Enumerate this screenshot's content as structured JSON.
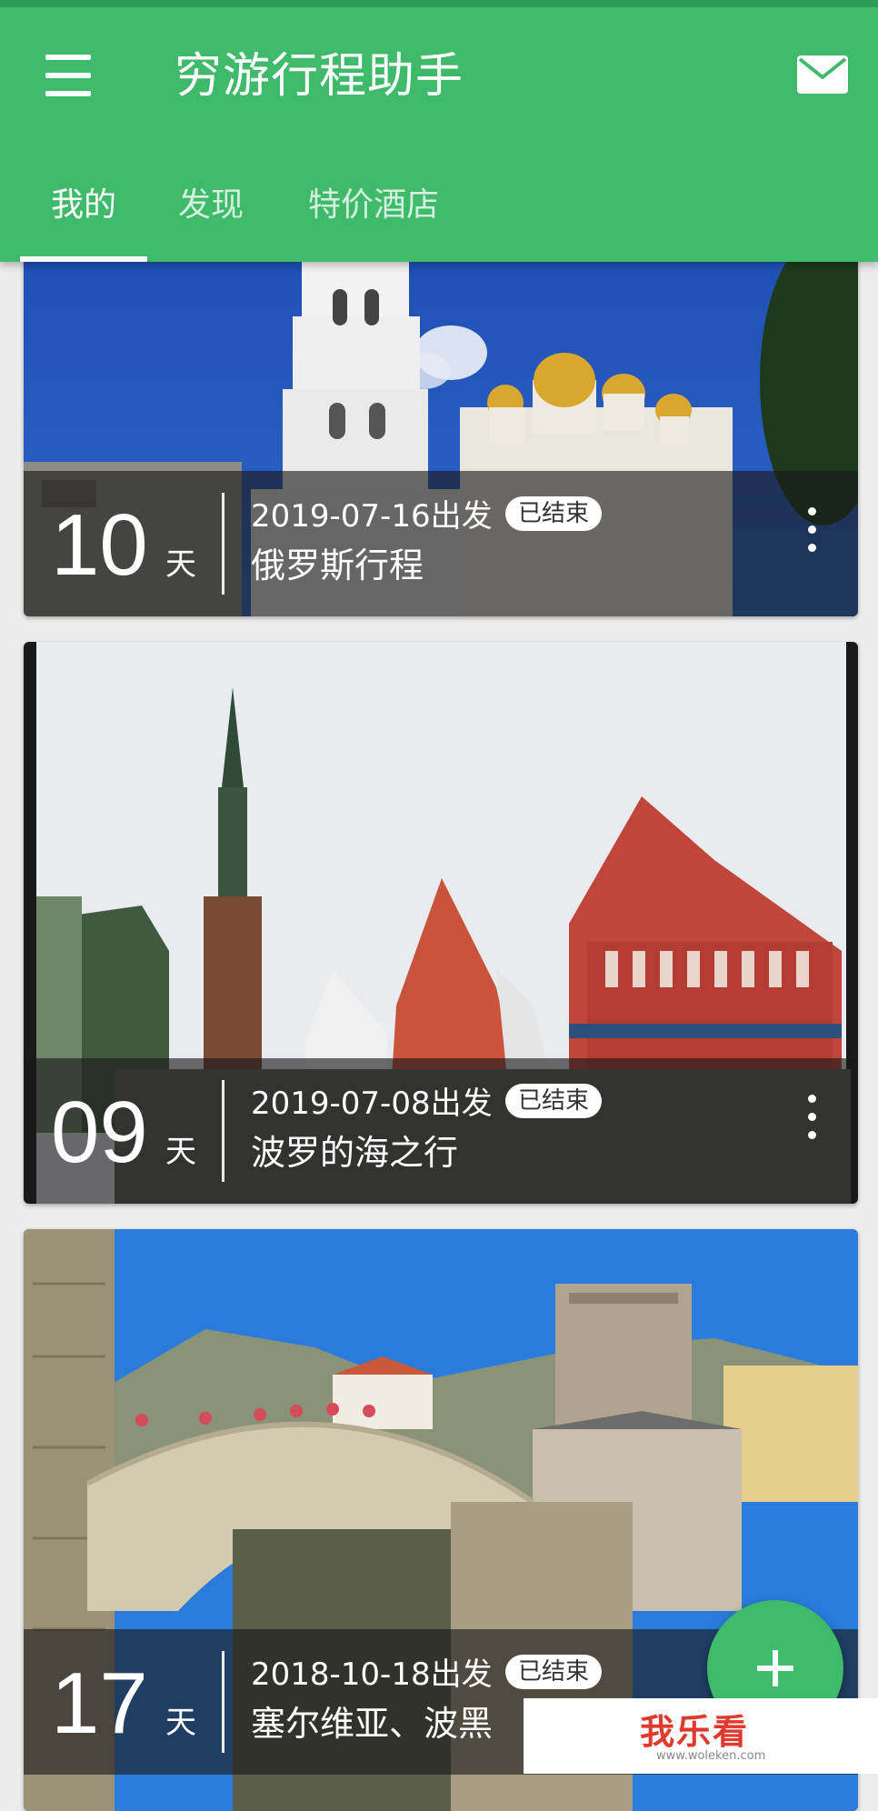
{
  "app": {
    "title": "穷游行程助手"
  },
  "tabs": [
    {
      "label": "我的",
      "active": true
    },
    {
      "label": "发现",
      "active": false
    },
    {
      "label": "特价酒店",
      "active": false
    }
  ],
  "icons": {
    "menu": "hamburger-menu-icon",
    "mail": "mail-icon",
    "more": "more-vertical-icon",
    "add": "plus-icon"
  },
  "colors": {
    "accent": "#3fba6a",
    "badge_bg": "#ffffff"
  },
  "trips": [
    {
      "days": "10",
      "unit": "天",
      "date": "2019-07-16出发",
      "status": "已结束",
      "name": "俄罗斯行程"
    },
    {
      "days": "09",
      "unit": "天",
      "date": "2019-07-08出发",
      "status": "已结束",
      "name": "波罗的海之行"
    },
    {
      "days": "17",
      "unit": "天",
      "date": "2018-10-18出发",
      "status": "已结束",
      "name": "塞尔维亚、波黑"
    }
  ],
  "watermark": {
    "text": "我乐看",
    "url": "www.woleken.com"
  }
}
